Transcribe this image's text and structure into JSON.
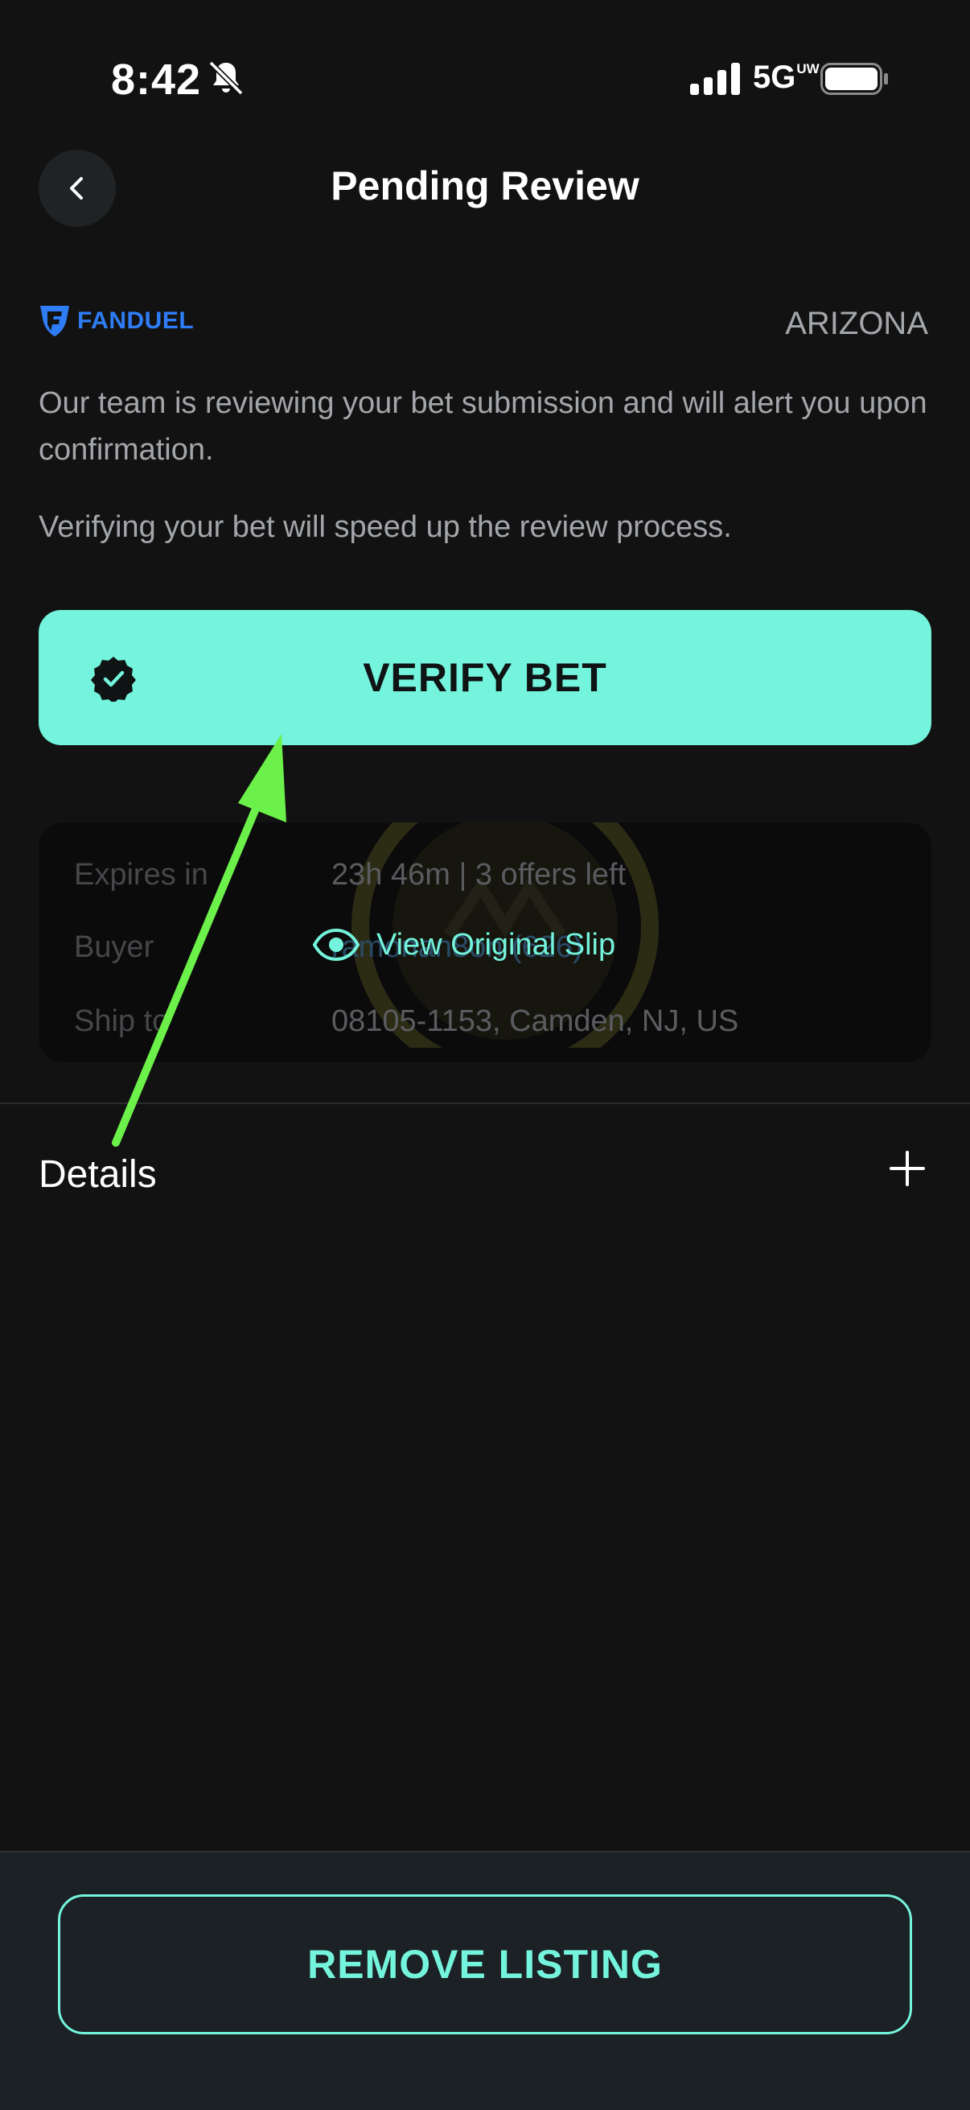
{
  "status_bar": {
    "time": "8:42",
    "network": "5G",
    "network_badge": "UW",
    "icons": [
      "bell-muted-icon",
      "cellular-signal-icon",
      "battery-icon"
    ]
  },
  "header": {
    "title": "Pending Review",
    "back_icon": "chevron-left-icon"
  },
  "sportsbook": {
    "name": "FANDUEL",
    "state": "ARIZONA"
  },
  "messages": {
    "review": "Our team is reviewing your bet submission and will alert you upon confirmation.",
    "speed_up": "Verifying your bet will speed up the review process."
  },
  "verify_button": {
    "label": "VERIFY BET",
    "icon": "verified-badge-icon"
  },
  "slip_preview": {
    "rows": [
      {
        "label": "Expires in",
        "value": "23h 46m | 3 offers left"
      },
      {
        "label": "Buyer",
        "value": "ramonan8on (626)"
      },
      {
        "label": "Ship to",
        "value": "08105-1153, Camden, NJ, US"
      }
    ],
    "view_link": "View Original Slip",
    "view_icon": "eye-icon"
  },
  "details": {
    "label": "Details",
    "expand_icon": "plus-icon"
  },
  "footer": {
    "remove_label": "REMOVE LISTING"
  },
  "colors": {
    "accent": "#74f4dc",
    "background": "#121212",
    "muted_text": "#a3a6aa",
    "fanduel_blue": "#2f7df6",
    "annotation_arrow": "#6cf04a"
  }
}
